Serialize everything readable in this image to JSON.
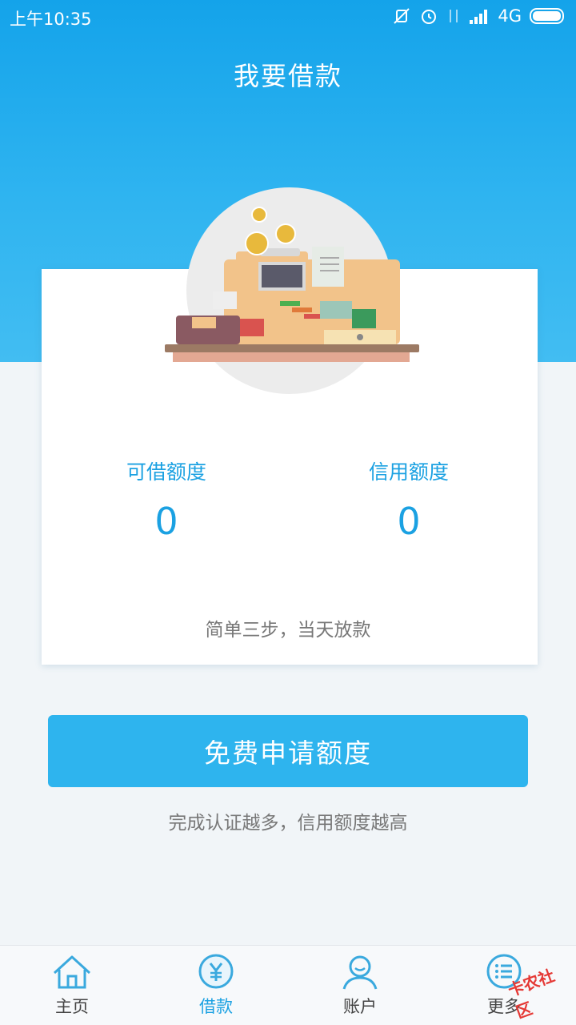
{
  "status_bar": {
    "time": "上午10:35",
    "network": "4G",
    "icons": [
      "mute-vibrate-icon",
      "alarm-icon",
      "data-arrows-icon",
      "signal-icon",
      "battery-icon"
    ]
  },
  "header": {
    "title": "我要借款"
  },
  "card": {
    "illustration": "cash-register-illustration",
    "available": {
      "label": "可借额度",
      "value": "0"
    },
    "credit": {
      "label": "信用额度",
      "value": "0"
    },
    "tip": "简单三步，当天放款"
  },
  "apply": {
    "button_label": "免费申请额度",
    "tip": "完成认证越多，信用额度越高"
  },
  "tabbar": {
    "items": [
      {
        "label": "主页",
        "icon": "home-icon",
        "active": false
      },
      {
        "label": "借款",
        "icon": "yuan-icon",
        "active": true
      },
      {
        "label": "账户",
        "icon": "user-icon",
        "active": false
      },
      {
        "label": "更多",
        "icon": "more-icon",
        "active": false
      }
    ]
  },
  "watermark": {
    "text": "卡农社区"
  },
  "colors": {
    "accent": "#1ba1e2",
    "header_bg": "#14a3ea",
    "button_bg": "#2eb4ee",
    "page_bg": "#f1f5f8"
  }
}
